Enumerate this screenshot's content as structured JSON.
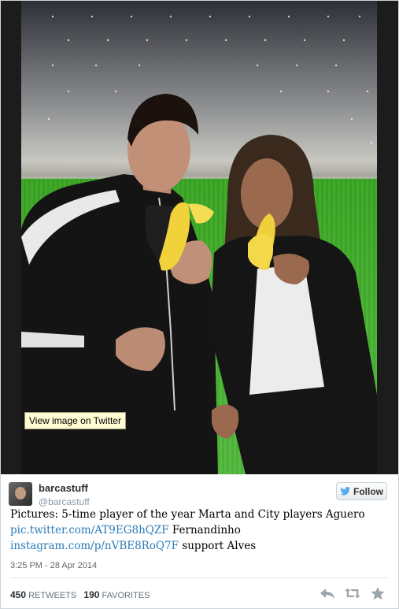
{
  "media": {
    "view_image_label": "View image on Twitter"
  },
  "tweet": {
    "author_name": "barcastuff",
    "author_handle": "@barcastuff",
    "follow_label": "Follow",
    "text_prefix": "Pictures: 5-time player of the year Marta and City players Aguero",
    "link1": "pic.twitter.com/AT9EG8hQZF",
    "text_mid": " Fernandinho",
    "link2": "instagram.com/p/nVBE8RoQ7F",
    "text_suffix": " support Alves",
    "timestamp": "3:25 PM - 28 Apr 2014",
    "retweets_count": "450",
    "retweets_label": "RETWEETS",
    "favorites_count": "190",
    "favorites_label": "FAVORITES"
  },
  "icons": {
    "follow": "twitter-bird-icon",
    "reply": "reply-icon",
    "retweet": "retweet-icon",
    "favorite": "star-icon"
  },
  "colors": {
    "link": "#2b7bb9",
    "twitter_blue": "#55acee",
    "icon_gray": "#9aa5ad"
  }
}
